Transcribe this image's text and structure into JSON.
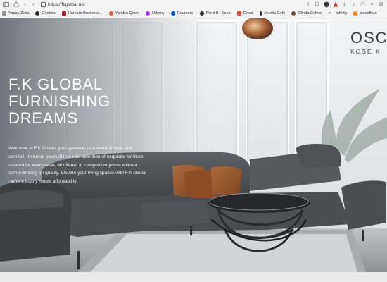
{
  "browser": {
    "url": "https://fkglobal.net",
    "bookmarks": [
      {
        "label": "Yapay Zeka",
        "icon": "folder-icon",
        "color": "#8a8f98"
      },
      {
        "label": "Coolors",
        "icon": "coolors-icon",
        "color": "#2a2a2a"
      },
      {
        "label": "Harvard Business...",
        "icon": "hbr-icon",
        "color": "#a6192e"
      },
      {
        "label": "Yandex Çeviri",
        "icon": "yandex-icon",
        "color": "#e1564b"
      },
      {
        "label": "Udemy",
        "icon": "udemy-icon",
        "color": "#a435f0"
      },
      {
        "label": "Coursera",
        "icon": "coursera-icon",
        "color": "#0056d2"
      },
      {
        "label": "Plant It | Soon",
        "icon": "plantit-icon",
        "color": "#2b2b2b"
      },
      {
        "label": "Gmail",
        "icon": "gmail-icon",
        "color": "#ea4335"
      },
      {
        "label": "Muella Cafe",
        "icon": "cafe-icon",
        "color": "#3c3c3c"
      },
      {
        "label": "Olinda Coffee",
        "icon": "coffee-icon",
        "color": "#6b4a2f"
      },
      {
        "label": "Infinity",
        "icon": "infinity-icon",
        "color": "#5a5a5a"
      },
      {
        "label": "cloudflare",
        "icon": "cloudflare-icon",
        "color": "#f38020"
      }
    ]
  },
  "hero": {
    "title_lines": [
      "F.K GLOBAL",
      "FURNISHING",
      "DREAMS"
    ],
    "description": "Welcome to F.K Global, your gateway to a world of style and comfort. Immerse yourself in a vast selection of exquisite furniture curated for every taste, all offered at competitive prices without compromising on quality. Elevate your living spaces with F.K Global - where luxury meets affordability."
  },
  "product": {
    "brand_name": "OSC",
    "brand_subtitle": "KÖŞE K"
  }
}
